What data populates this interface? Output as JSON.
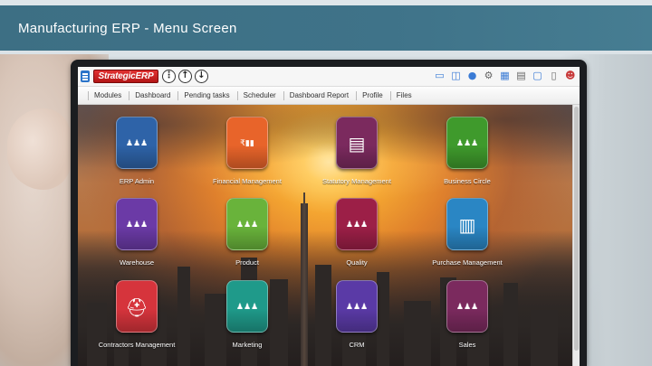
{
  "slide": {
    "title": "Manufacturing ERP - Menu Screen"
  },
  "app": {
    "logo_text": "StrategicERP",
    "info_button": "⋮",
    "upload_button": "↑",
    "download_button": "↓"
  },
  "topbar_icons": [
    "card-icon",
    "cart-icon",
    "microphone-icon",
    "gear-icon",
    "calculator-icon",
    "calendar-icon",
    "monitor-icon",
    "mobile-icon",
    "user-icon"
  ],
  "nav": {
    "items": [
      "Modules",
      "Dashboard",
      "Pending tasks",
      "Scheduler",
      "Dashboard Report",
      "Profile",
      "Files"
    ]
  },
  "tiles": [
    {
      "label": "ERP Admin",
      "color": "#2e63a8",
      "icon": "users-icon"
    },
    {
      "label": "Financial Management",
      "color": "#e8642a",
      "icon": "finance-chart-icon"
    },
    {
      "label": "Statutory Management",
      "color": "#7b2a5e",
      "icon": "document-icon"
    },
    {
      "label": "Business Circle",
      "color": "#3f9a2c",
      "icon": "users-icon"
    },
    {
      "label": "Warehouse",
      "color": "#6b3aa6",
      "icon": "users-icon"
    },
    {
      "label": "Product",
      "color": "#69b33b",
      "icon": "users-icon"
    },
    {
      "label": "Quality",
      "color": "#9c1f47",
      "icon": "users-icon"
    },
    {
      "label": "Purchase Management",
      "color": "#2a86c4",
      "icon": "invoice-icon"
    },
    {
      "label": "Contractors Management",
      "color": "#d6343c",
      "icon": "hard-hat-icon"
    },
    {
      "label": "Marketing",
      "color": "#1f9a8a",
      "icon": "users-icon"
    },
    {
      "label": "CRM",
      "color": "#5a3aa6",
      "icon": "users-icon"
    },
    {
      "label": "Sales",
      "color": "#7b2a5e",
      "icon": "users-icon"
    }
  ]
}
